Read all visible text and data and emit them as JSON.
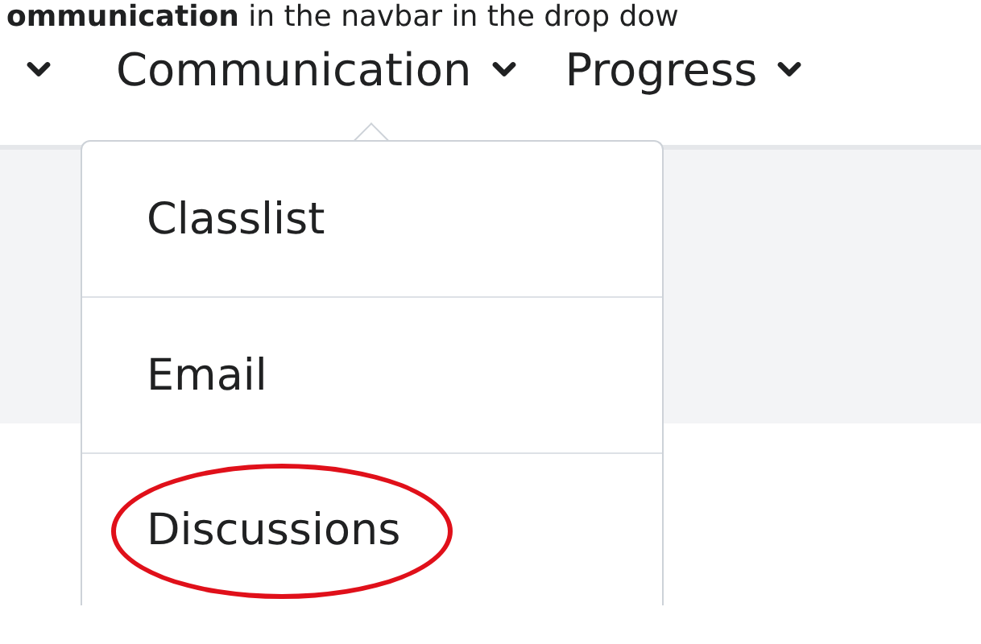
{
  "caption": "**ommunication** in the navbar in the drop dow",
  "navbar": {
    "items": [
      {
        "kind": "chevron"
      },
      {
        "kind": "menu",
        "label": "Communication"
      },
      {
        "kind": "menu",
        "label": "Progress"
      }
    ]
  },
  "dropdown": {
    "items": [
      {
        "label": "Classlist",
        "circled": false
      },
      {
        "label": "Email",
        "circled": false
      },
      {
        "label": "Discussions",
        "circled": true
      }
    ]
  }
}
